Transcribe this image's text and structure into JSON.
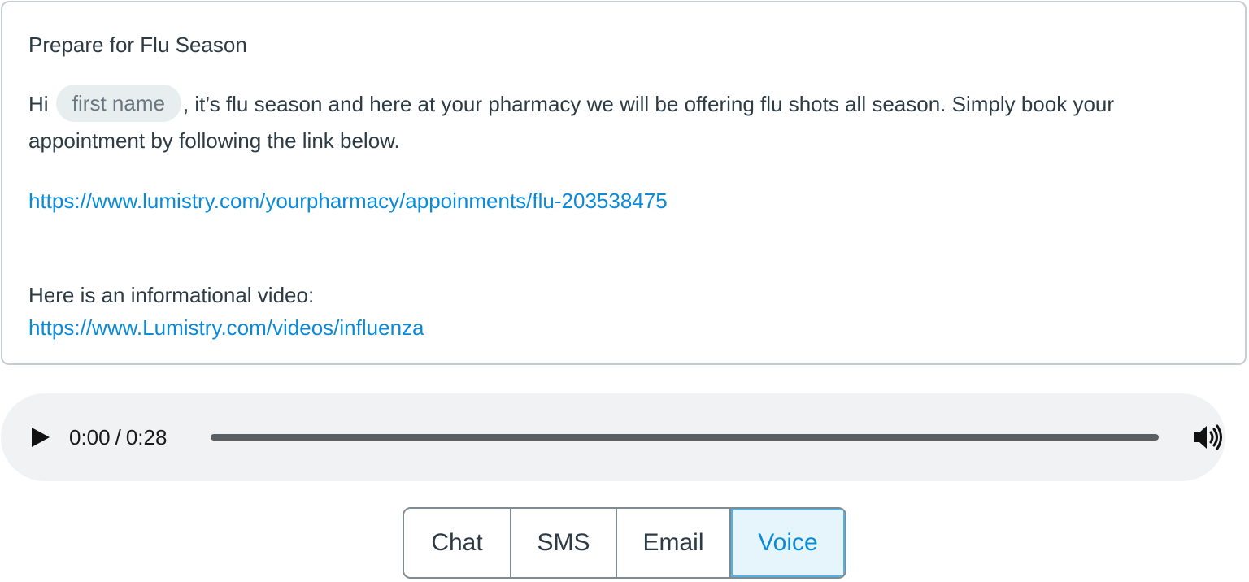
{
  "message": {
    "subject": "Prepare for Flu Season",
    "greeting": "Hi",
    "placeholder_chip": "first name",
    "body_text": ", it’s flu season and here at your pharmacy we will be offering flu shots all season. Simply book your appointment by following the link below.",
    "booking_link": "https://www.lumistry.com/yourpharmacy/appoinments/flu-203538475",
    "video_label": "Here is an informational video:",
    "video_link": "https://www.Lumistry.com/videos/influenza"
  },
  "audio": {
    "current_time": "0:00",
    "separator": "/",
    "duration": "0:28",
    "progress_fraction": 0,
    "play_icon": "play-icon",
    "volume_icon": "volume-icon"
  },
  "channels": {
    "tabs": [
      {
        "label": "Chat",
        "active": false
      },
      {
        "label": "SMS",
        "active": false
      },
      {
        "label": "Email",
        "active": false
      },
      {
        "label": "Voice",
        "active": true
      }
    ]
  },
  "colors": {
    "link": "#0b8ad8",
    "active_tab_bg": "#e6f4fb",
    "active_tab_text": "#0b8ad8",
    "chip_bg": "#e8edf0",
    "player_bg": "#f0f2f4"
  }
}
